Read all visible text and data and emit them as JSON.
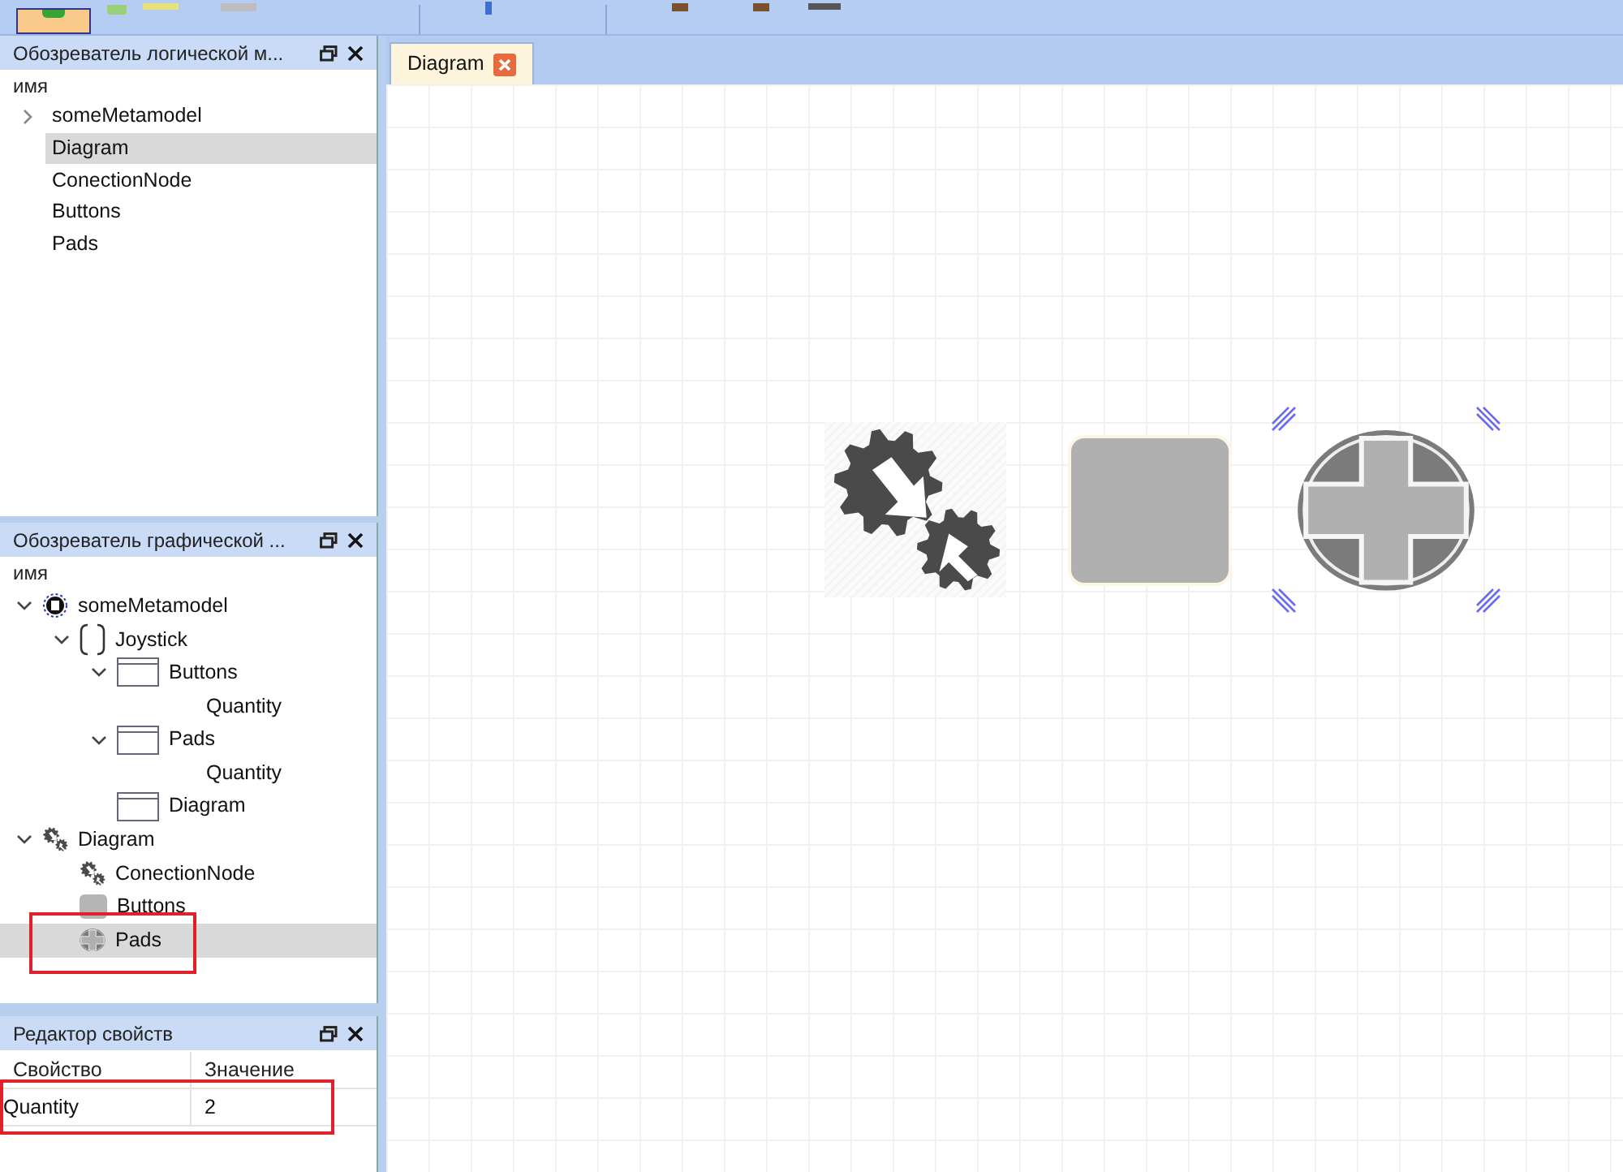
{
  "logical_explorer": {
    "title": "Обозреватель логической м...",
    "column": "имя",
    "items": [
      {
        "label": "someMetamodel",
        "expanded": false,
        "selected": false
      },
      {
        "label": "Diagram",
        "selected": true
      },
      {
        "label": "ConectionNode",
        "selected": false
      },
      {
        "label": "Buttons",
        "selected": false
      },
      {
        "label": "Pads",
        "selected": false
      }
    ]
  },
  "graphical_explorer": {
    "title": "Обозреватель графической ...",
    "column": "имя",
    "items": [
      {
        "label": "someMetamodel",
        "kind": "metamodel",
        "expanded": true,
        "selected": false,
        "highlighted": false,
        "children": [
          {
            "label": "Joystick",
            "kind": "group",
            "expanded": true,
            "selected": false,
            "highlighted": false,
            "children": [
              {
                "label": "Buttons",
                "kind": "element",
                "expanded": true,
                "selected": false,
                "highlighted": false,
                "children": [
                  {
                    "label": "Quantity",
                    "kind": "attribute",
                    "selected": false,
                    "highlighted": false
                  }
                ]
              },
              {
                "label": "Pads",
                "kind": "element",
                "expanded": true,
                "selected": false,
                "highlighted": false,
                "children": [
                  {
                    "label": "Quantity",
                    "kind": "attribute",
                    "selected": false,
                    "highlighted": false
                  }
                ]
              },
              {
                "label": "Diagram",
                "kind": "element",
                "selected": false,
                "highlighted": false
              }
            ]
          }
        ]
      },
      {
        "label": "Diagram",
        "kind": "diagram",
        "expanded": true,
        "selected": false,
        "highlighted": false,
        "children": [
          {
            "label": "ConectionNode",
            "kind": "gears",
            "selected": false,
            "highlighted": false
          },
          {
            "label": "Buttons",
            "kind": "button",
            "selected": false,
            "highlighted": false
          },
          {
            "label": "Pads",
            "kind": "pad",
            "selected": true,
            "highlighted": true
          }
        ]
      }
    ]
  },
  "property_editor": {
    "title": "Редактор свойств",
    "columns": [
      "Свойство",
      "Значение"
    ],
    "rows": [
      {
        "property": "Quantity",
        "value": "2",
        "highlighted": true
      }
    ]
  },
  "editor_tabs": [
    {
      "label": "Diagram",
      "selected": true
    }
  ],
  "canvas_nodes": [
    {
      "kind": "gears",
      "selected": false
    },
    {
      "kind": "button",
      "selected": false
    },
    {
      "kind": "pad",
      "selected": true
    }
  ]
}
